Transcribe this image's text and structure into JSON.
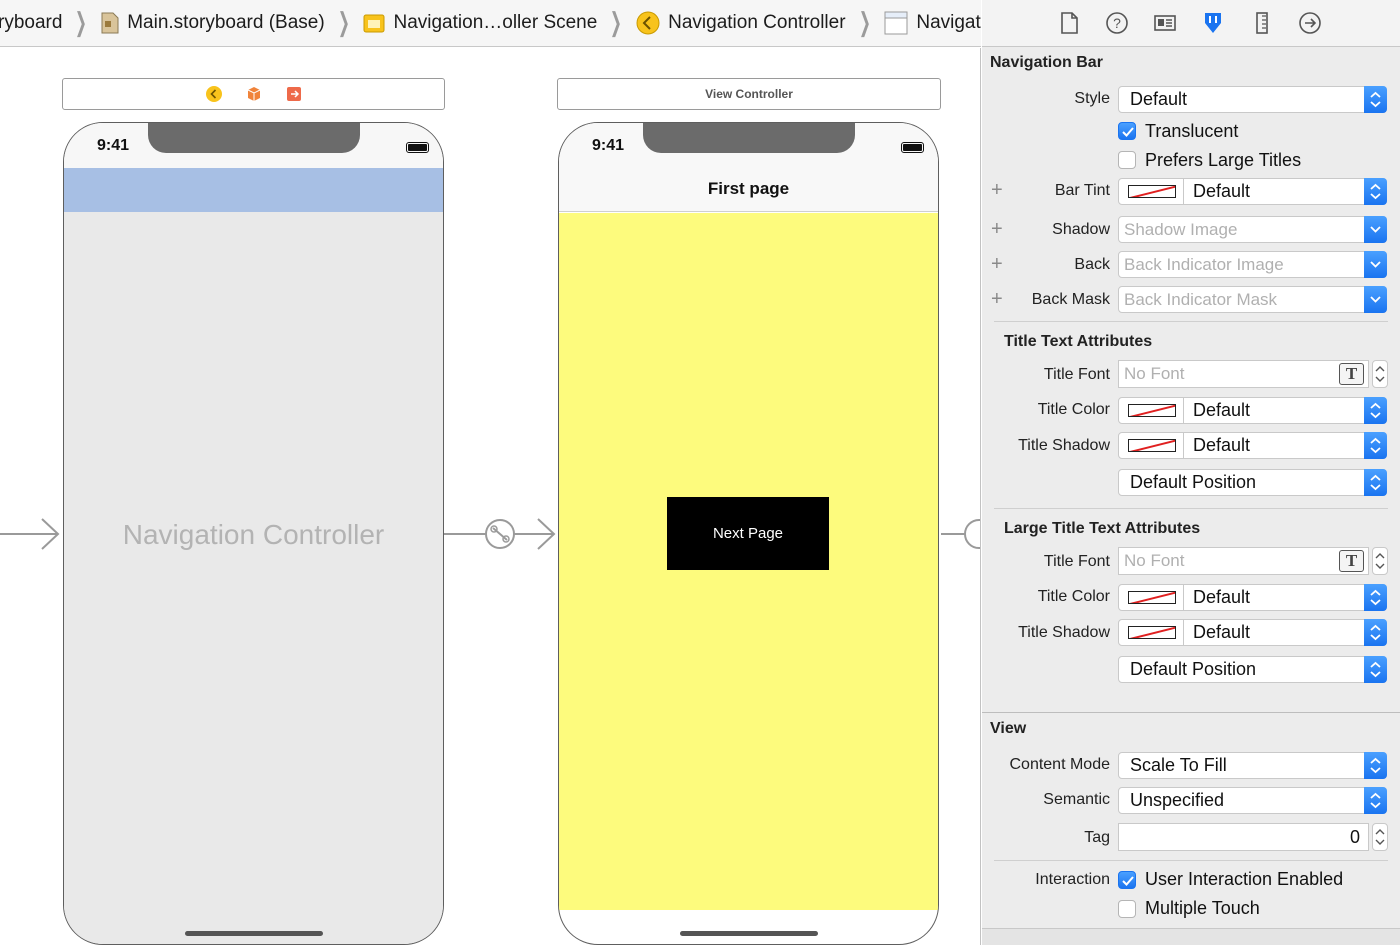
{
  "breadcrumb": [
    {
      "label": "ryboard",
      "icon": "storyboard-icon"
    },
    {
      "label": "Main.storyboard (Base)",
      "icon": "storyboard-file-icon"
    },
    {
      "label": "Navigation…oller Scene",
      "icon": "scene-icon"
    },
    {
      "label": "Navigation Controller",
      "icon": "navigation-controller-icon"
    },
    {
      "label": "Navigation Bar",
      "icon": "navigation-bar-icon"
    }
  ],
  "canvas": {
    "nav_scene": {
      "title": "Navigation Controller",
      "time": "9:41",
      "navbar_color": "#a7bfe4",
      "body_color": "#e9e9e9"
    },
    "vc_scene": {
      "bar_title": "View Controller",
      "time": "9:41",
      "nav_title": "First page",
      "button_label": "Next Page",
      "body_color": "#fdfb7d"
    }
  },
  "inspector": {
    "tabs": [
      "file-inspector-icon",
      "quick-help-icon",
      "identity-inspector-icon",
      "attributes-inspector-icon",
      "size-inspector-icon",
      "connections-inspector-icon"
    ],
    "active_tab": "attributes-inspector-icon",
    "accent": "#1a74f0",
    "navigation_bar": {
      "title": "Navigation Bar",
      "style_label": "Style",
      "style_value": "Default",
      "translucent_label": "Translucent",
      "translucent_checked": true,
      "large_titles_label": "Prefers Large Titles",
      "large_titles_checked": false,
      "bar_tint_label": "Bar Tint",
      "bar_tint_value": "Default",
      "shadow_label": "Shadow",
      "shadow_placeholder": "Shadow Image",
      "back_label": "Back",
      "back_placeholder": "Back Indicator Image",
      "back_mask_label": "Back Mask",
      "back_mask_placeholder": "Back Indicator Mask"
    },
    "title_text": {
      "title": "Title Text Attributes",
      "font_label": "Title Font",
      "font_value": "No Font",
      "color_label": "Title Color",
      "color_value": "Default",
      "shadow_label": "Title Shadow",
      "shadow_value": "Default",
      "position_value": "Default Position"
    },
    "large_title_text": {
      "title": "Large Title Text Attributes",
      "font_label": "Title Font",
      "font_value": "No Font",
      "color_label": "Title Color",
      "color_value": "Default",
      "shadow_label": "Title Shadow",
      "shadow_value": "Default",
      "position_value": "Default Position"
    },
    "view": {
      "title": "View",
      "content_mode_label": "Content Mode",
      "content_mode_value": "Scale To Fill",
      "semantic_label": "Semantic",
      "semantic_value": "Unspecified",
      "tag_label": "Tag",
      "tag_value": "0",
      "interaction_label": "Interaction",
      "user_interaction_label": "User Interaction Enabled",
      "user_interaction_checked": true,
      "multiple_touch_label": "Multiple Touch",
      "multiple_touch_checked": false
    }
  }
}
